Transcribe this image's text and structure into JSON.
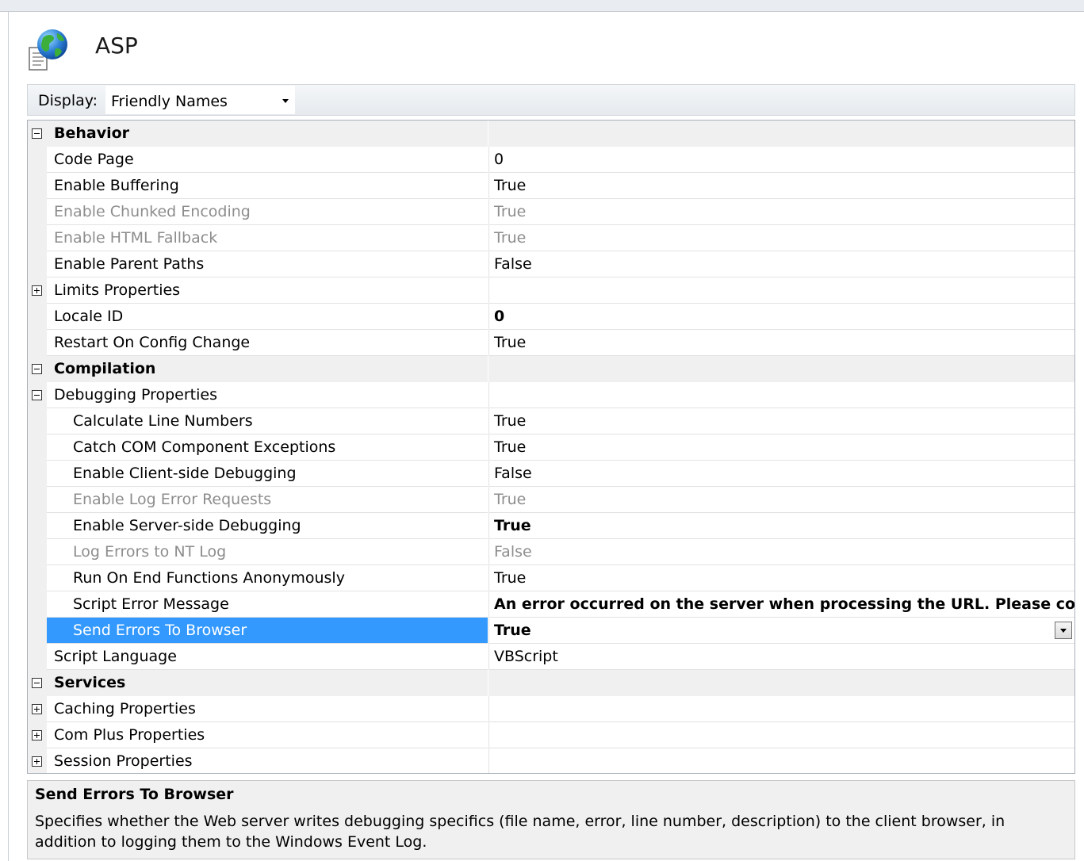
{
  "page": {
    "title": "ASP",
    "icon": "globe-document-icon"
  },
  "toolbar": {
    "display_label": "Display:",
    "display_value": "Friendly Names"
  },
  "grid": {
    "rows": [
      {
        "kind": "category",
        "name": "Behavior",
        "toggle": "minus"
      },
      {
        "kind": "prop",
        "indent": 0,
        "name": "Code Page",
        "value": "0"
      },
      {
        "kind": "prop",
        "indent": 0,
        "name": "Enable Buffering",
        "value": "True"
      },
      {
        "kind": "prop",
        "indent": 0,
        "name": "Enable Chunked Encoding",
        "value": "True",
        "disabled": true
      },
      {
        "kind": "prop",
        "indent": 0,
        "name": "Enable HTML Fallback",
        "value": "True",
        "disabled": true
      },
      {
        "kind": "prop",
        "indent": 0,
        "name": "Enable Parent Paths",
        "value": "False"
      },
      {
        "kind": "prop",
        "indent": 0,
        "name": "Limits Properties",
        "value": "",
        "toggle": "plus"
      },
      {
        "kind": "prop",
        "indent": 0,
        "name": "Locale ID",
        "value": "0",
        "bold": true
      },
      {
        "kind": "prop",
        "indent": 0,
        "name": "Restart On Config Change",
        "value": "True"
      },
      {
        "kind": "category",
        "name": "Compilation",
        "toggle": "minus"
      },
      {
        "kind": "prop",
        "indent": 0,
        "name": "Debugging Properties",
        "value": "",
        "toggle": "minus"
      },
      {
        "kind": "prop",
        "indent": 1,
        "name": "Calculate Line Numbers",
        "value": "True"
      },
      {
        "kind": "prop",
        "indent": 1,
        "name": "Catch COM Component Exceptions",
        "value": "True"
      },
      {
        "kind": "prop",
        "indent": 1,
        "name": "Enable Client-side Debugging",
        "value": "False"
      },
      {
        "kind": "prop",
        "indent": 1,
        "name": "Enable Log Error Requests",
        "value": "True",
        "disabled": true
      },
      {
        "kind": "prop",
        "indent": 1,
        "name": "Enable Server-side Debugging",
        "value": "True",
        "bold": true
      },
      {
        "kind": "prop",
        "indent": 1,
        "name": "Log Errors to NT Log",
        "value": "False",
        "disabled": true
      },
      {
        "kind": "prop",
        "indent": 1,
        "name": "Run On End Functions Anonymously",
        "value": "True"
      },
      {
        "kind": "prop",
        "indent": 1,
        "name": "Script Error Message",
        "value": "An error occurred on the server when processing the URL. Please contact th",
        "bold": true
      },
      {
        "kind": "prop",
        "indent": 1,
        "name": "Send Errors To Browser",
        "value": "True",
        "bold": true,
        "selected": true,
        "dropdown": true
      },
      {
        "kind": "prop",
        "indent": 0,
        "name": "Script Language",
        "value": "VBScript"
      },
      {
        "kind": "category",
        "name": "Services",
        "toggle": "minus"
      },
      {
        "kind": "prop",
        "indent": 0,
        "name": "Caching Properties",
        "value": "",
        "toggle": "plus"
      },
      {
        "kind": "prop",
        "indent": 0,
        "name": "Com Plus Properties",
        "value": "",
        "toggle": "plus"
      },
      {
        "kind": "prop",
        "indent": 0,
        "name": "Session Properties",
        "value": "",
        "toggle": "plus"
      }
    ]
  },
  "description": {
    "title": "Send Errors To Browser",
    "text": "Specifies whether the Web server writes debugging specifics (file name, error, line number, description) to the client browser, in addition to logging them to the Windows Event Log."
  }
}
